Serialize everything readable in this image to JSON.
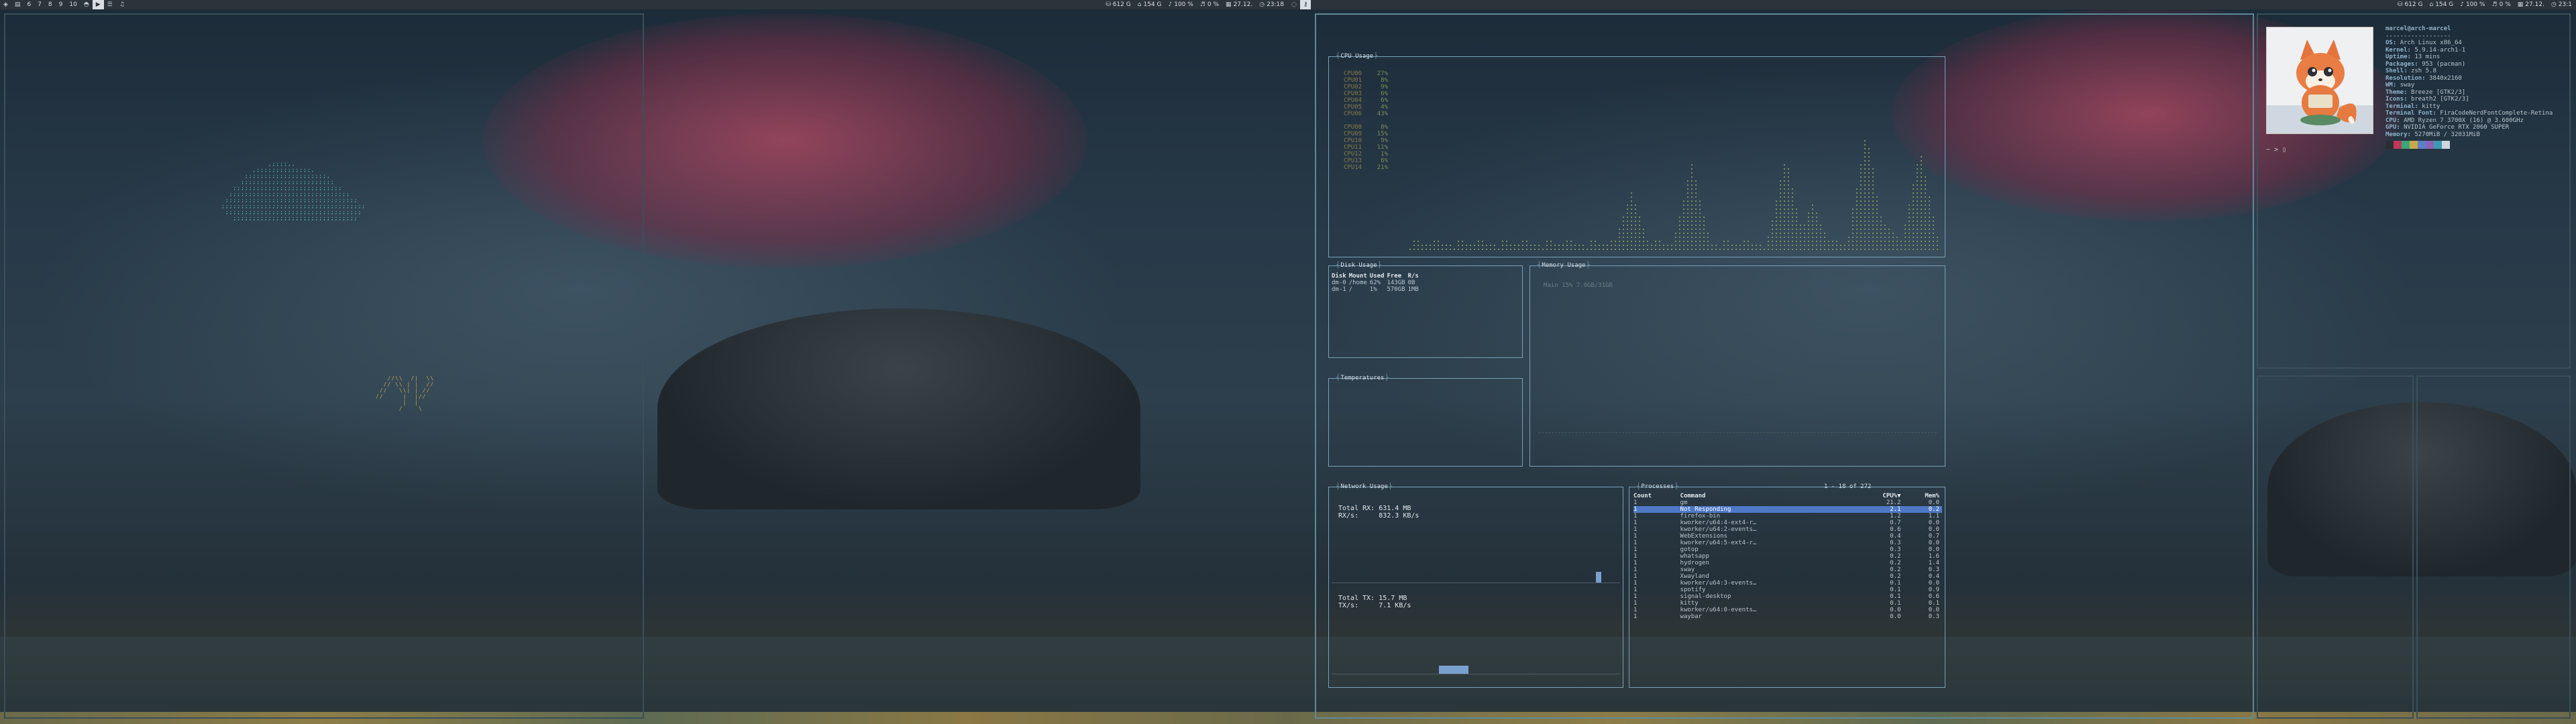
{
  "topbar_left": {
    "workspaces": [
      "6",
      "7",
      "8",
      "9",
      "10"
    ],
    "left_glyphs": [
      "app-icon",
      "doc-icon"
    ],
    "extra_glyphs": [
      "discord-icon",
      "youtube-icon",
      "list-icon",
      "music-icon"
    ]
  },
  "topbar_right": {
    "workspace_glyphs": [
      "chat-icon",
      "key-icon"
    ]
  },
  "tray": {
    "disk_root": "612 G",
    "disk_home": "154 G",
    "volume": "100 %",
    "music": "0 %",
    "date": "27.12.",
    "time": "23:18"
  },
  "tray_right_screen": {
    "disk_root": "612 G",
    "disk_home": "154 G",
    "volume": "100 %",
    "music": "0 %",
    "date": "27.12.",
    "time": "23:1"
  },
  "btop": {
    "cpu_title": "CPU Usage",
    "cpu_cores": [
      {
        "name": "CPU00",
        "val": "27%"
      },
      {
        "name": "CPU01",
        "val": "8%"
      },
      {
        "name": "CPU02",
        "val": "9%"
      },
      {
        "name": "CPU03",
        "val": "6%"
      },
      {
        "name": "CPU04",
        "val": "6%"
      },
      {
        "name": "CPU05",
        "val": "4%"
      },
      {
        "name": "CPU06",
        "val": "43%"
      },
      {
        "name": "CPU08",
        "val": "8%"
      },
      {
        "name": "CPU09",
        "val": "15%"
      },
      {
        "name": "CPU10",
        "val": "9%"
      },
      {
        "name": "CPU11",
        "val": "11%"
      },
      {
        "name": "CPU12",
        "val": "1%"
      },
      {
        "name": "CPU13",
        "val": "6%"
      },
      {
        "name": "CPU14",
        "val": "21%"
      }
    ],
    "disk_title": "Disk Usage",
    "disk_headers": [
      "Disk",
      "Mount",
      "Used",
      "Free",
      "R/s"
    ],
    "disk_rows": [
      [
        "dm-0",
        "/home",
        "62%",
        "143GB",
        "0B"
      ],
      [
        "dm-1",
        "/",
        "1%",
        "570GB",
        "1MB"
      ]
    ],
    "mem_title": "Memory Usage",
    "mem_line": "Main 15%  7.0GB/31GB",
    "temp_title": "Temperatures",
    "net_title": "Network Usage",
    "net_rx_total_label": "Total RX:",
    "net_rx_total": "631.4 MB",
    "net_rx_rate_label": "RX/s:",
    "net_rx_rate": "832.3 KB/s",
    "net_tx_total_label": "Total TX:",
    "net_tx_total": "15.7 MB",
    "net_tx_rate_label": "TX/s:",
    "net_tx_rate": "7.1 KB/s",
    "proc_title": "Processes",
    "proc_count": "1 - 18 of 272",
    "proc_headers": [
      "Count",
      "Command",
      "CPU%▼",
      "Mem%"
    ],
    "processes": [
      [
        "1",
        "gm",
        "21.2",
        "0.0"
      ],
      [
        "1",
        "Not Responding",
        "2.1",
        "0.2"
      ],
      [
        "1",
        "firefox-bin",
        "1.2",
        "1.1"
      ],
      [
        "1",
        "kworker/u64:4-ext4-r…",
        "0.7",
        "0.0"
      ],
      [
        "1",
        "kworker/u64:2-events…",
        "0.6",
        "0.0"
      ],
      [
        "1",
        "WebExtensions",
        "0.4",
        "0.7"
      ],
      [
        "1",
        "kworker/u64:5-ext4-r…",
        "0.3",
        "0.0"
      ],
      [
        "1",
        "gotop",
        "0.3",
        "0.0"
      ],
      [
        "1",
        "whatsapp",
        "0.2",
        "1.6"
      ],
      [
        "1",
        "hydrogen",
        "0.2",
        "1.4"
      ],
      [
        "1",
        "sway",
        "0.2",
        "0.3"
      ],
      [
        "1",
        "Xwayland",
        "0.2",
        "0.4"
      ],
      [
        "1",
        "kworker/u64:3-events…",
        "0.1",
        "0.0"
      ],
      [
        "1",
        "spotify",
        "0.1",
        "0.9"
      ],
      [
        "1",
        "signal-desktop",
        "0.1",
        "0.6"
      ],
      [
        "1",
        "kitty",
        "0.1",
        "0.1"
      ],
      [
        "1",
        "kworker/u64:0-events…",
        "0.0",
        "0.0"
      ],
      [
        "1",
        "waybar",
        "0.0",
        "0.3"
      ]
    ]
  },
  "neofetch": {
    "userhost": "marcel@arch-marcel",
    "separator": "------------------",
    "fields": [
      {
        "k": "OS:",
        "v": "Arch Linux x86_64"
      },
      {
        "k": "Kernel:",
        "v": "5.9.14-arch1-1"
      },
      {
        "k": "Uptime:",
        "v": "13 mins"
      },
      {
        "k": "Packages:",
        "v": "953 (pacman)"
      },
      {
        "k": "Shell:",
        "v": "zsh 5.8"
      },
      {
        "k": "Resolution:",
        "v": "3840x2160"
      },
      {
        "k": "WM:",
        "v": "sway"
      },
      {
        "k": "Theme:",
        "v": "Breeze [GTK2/3]"
      },
      {
        "k": "Icons:",
        "v": "breath2 [GTK2/3]"
      },
      {
        "k": "Terminal:",
        "v": "kitty"
      },
      {
        "k": "Terminal Font:",
        "v": "FiraCodeNerdFontComplete-Retina"
      },
      {
        "k": "CPU:",
        "v": "AMD Ryzen 7 3700X (16) @ 3.600GHz"
      },
      {
        "k": "GPU:",
        "v": "NVIDIA GeForce RTX 2060 SUPER"
      },
      {
        "k": "Memory:",
        "v": "5270MiB / 32031MiB"
      }
    ],
    "swatch_colors": [
      "#2a2f36",
      "#c0395a",
      "#3aa67a",
      "#c9a84a",
      "#5b7fc4",
      "#8c62b8",
      "#3a9bb0",
      "#cfd6dc"
    ],
    "prompt": "~ > ▯"
  },
  "colors": {
    "accent": "#7aa0b8",
    "selected": "#4e79c6",
    "bar_bg": "#2b333b"
  }
}
